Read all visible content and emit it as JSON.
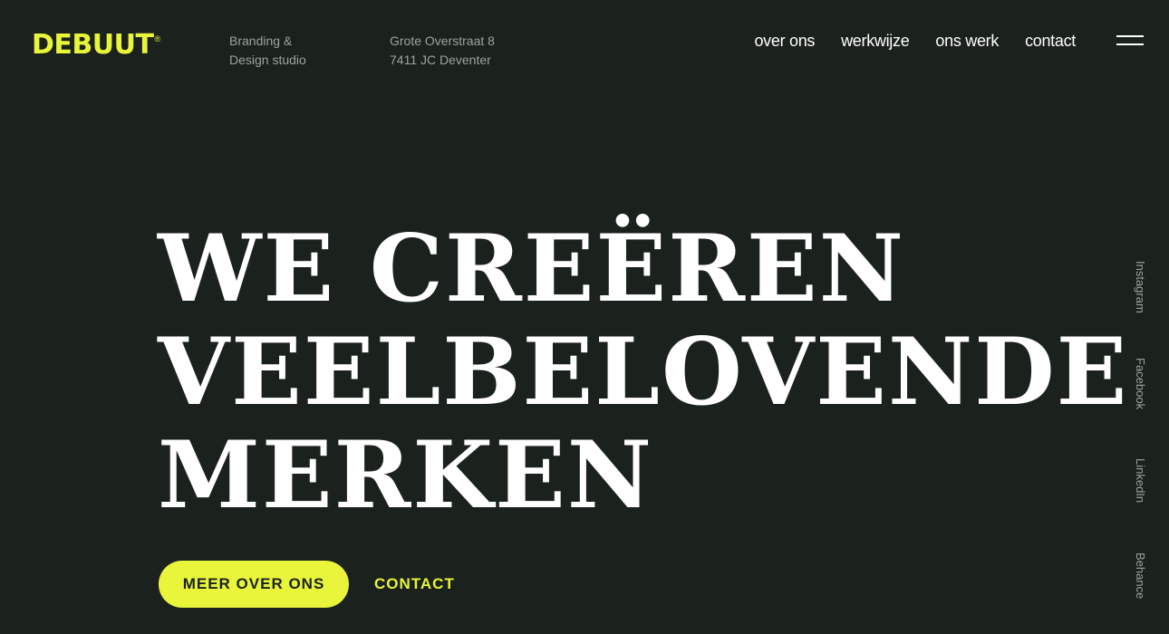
{
  "brand": {
    "logo_text": "DEBUUT",
    "registered_mark": "®",
    "tagline": [
      "Branding &",
      "Design studio"
    ],
    "address": [
      "Grote Overstraat 8",
      "7411 JC Deventer"
    ]
  },
  "nav": {
    "items": [
      "over ons",
      "werkwijze",
      "ons werk",
      "contact"
    ]
  },
  "hero": {
    "lines": [
      "WE CREËREN",
      "VEELBELOVENDE",
      "MERKEN"
    ],
    "primary_button": "MEER OVER ONS",
    "secondary_link": "CONTACT"
  },
  "social": {
    "items": [
      "Instagram",
      "Facebook",
      "LinkedIn",
      "Behance"
    ]
  },
  "colors": {
    "background": "#1b211d",
    "accent": "#e8f53a",
    "text": "#ffffff",
    "muted": "#9ea39f"
  },
  "icons": {
    "menu": "hamburger-menu-icon"
  }
}
